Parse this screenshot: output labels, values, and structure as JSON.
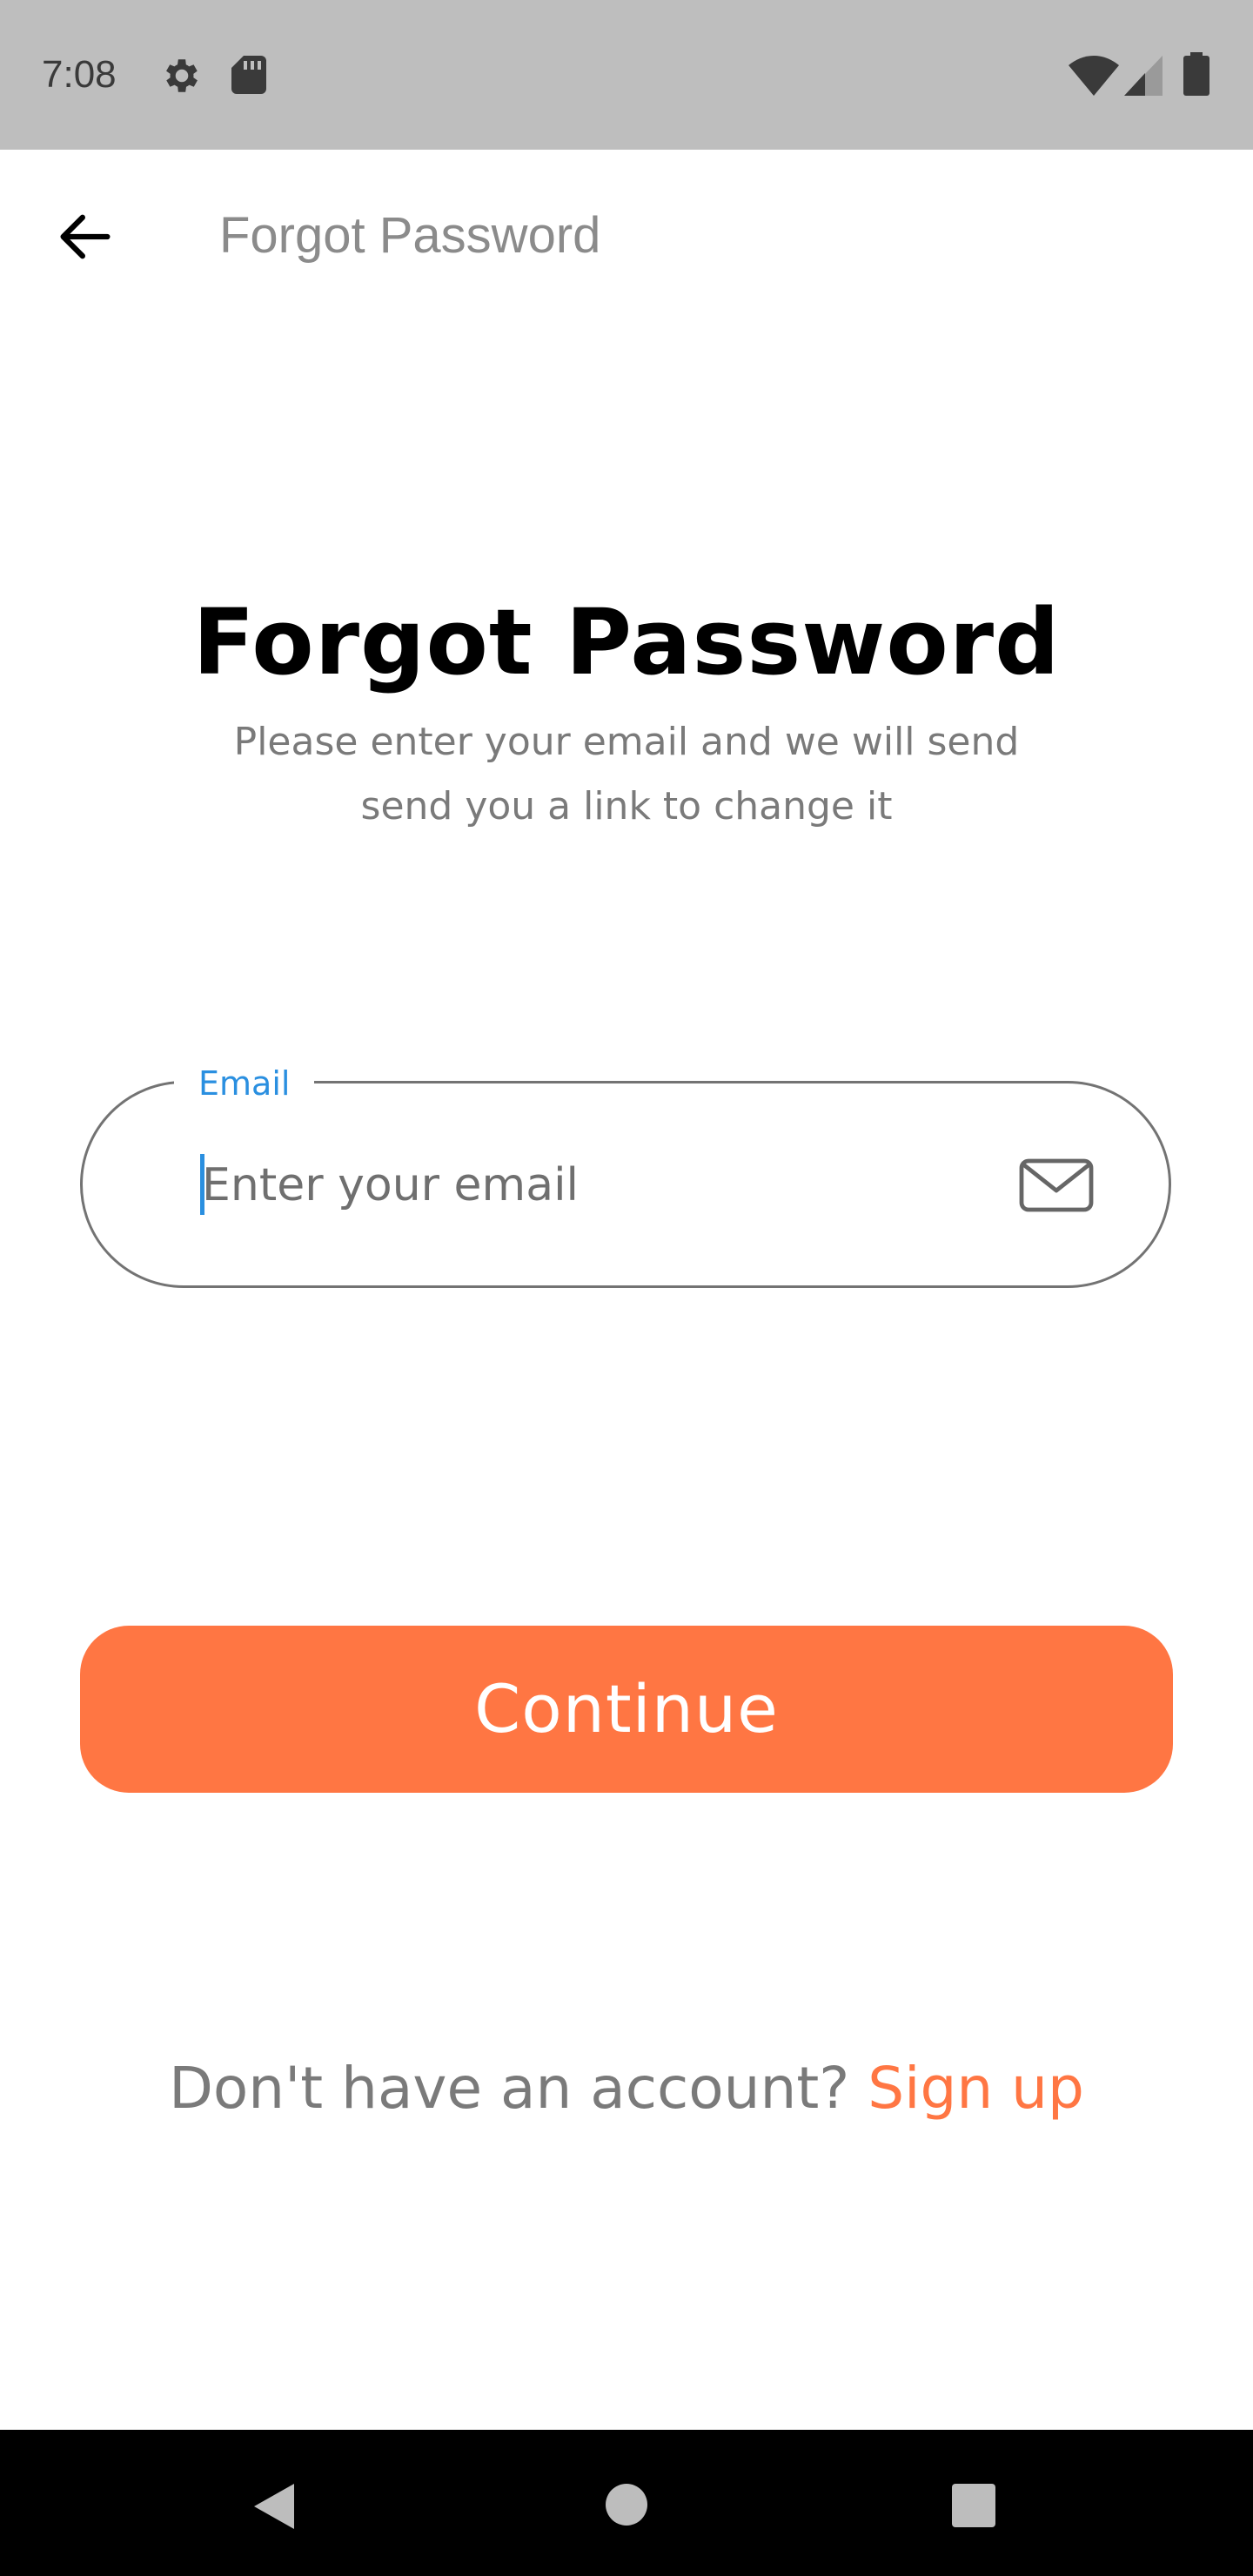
{
  "status_bar": {
    "time": "7:08",
    "icons": [
      "gear-icon",
      "sd-card-icon",
      "wifi-icon",
      "signal-icon",
      "battery-icon"
    ]
  },
  "app_bar": {
    "back_icon": "arrow-left-icon",
    "title": "Forgot Password"
  },
  "main": {
    "heading": "Forgot Password",
    "subheading_line1": "Please enter your email and we will send",
    "subheading_line2": "send you a link to change it",
    "email": {
      "label": "Email",
      "placeholder": "Enter your email",
      "value": "",
      "icon": "mail-icon"
    },
    "continue_label": "Continue",
    "signup_prompt": "Don't have an account? ",
    "signup_link": "Sign up"
  },
  "colors": {
    "accent": "#ff7643",
    "focus": "#2a8fe0",
    "status_bar_bg": "#bebebe",
    "nav_bar_bg": "#000000"
  },
  "nav_bar": {
    "icons": [
      "nav-back-icon",
      "nav-home-icon",
      "nav-recents-icon"
    ]
  }
}
